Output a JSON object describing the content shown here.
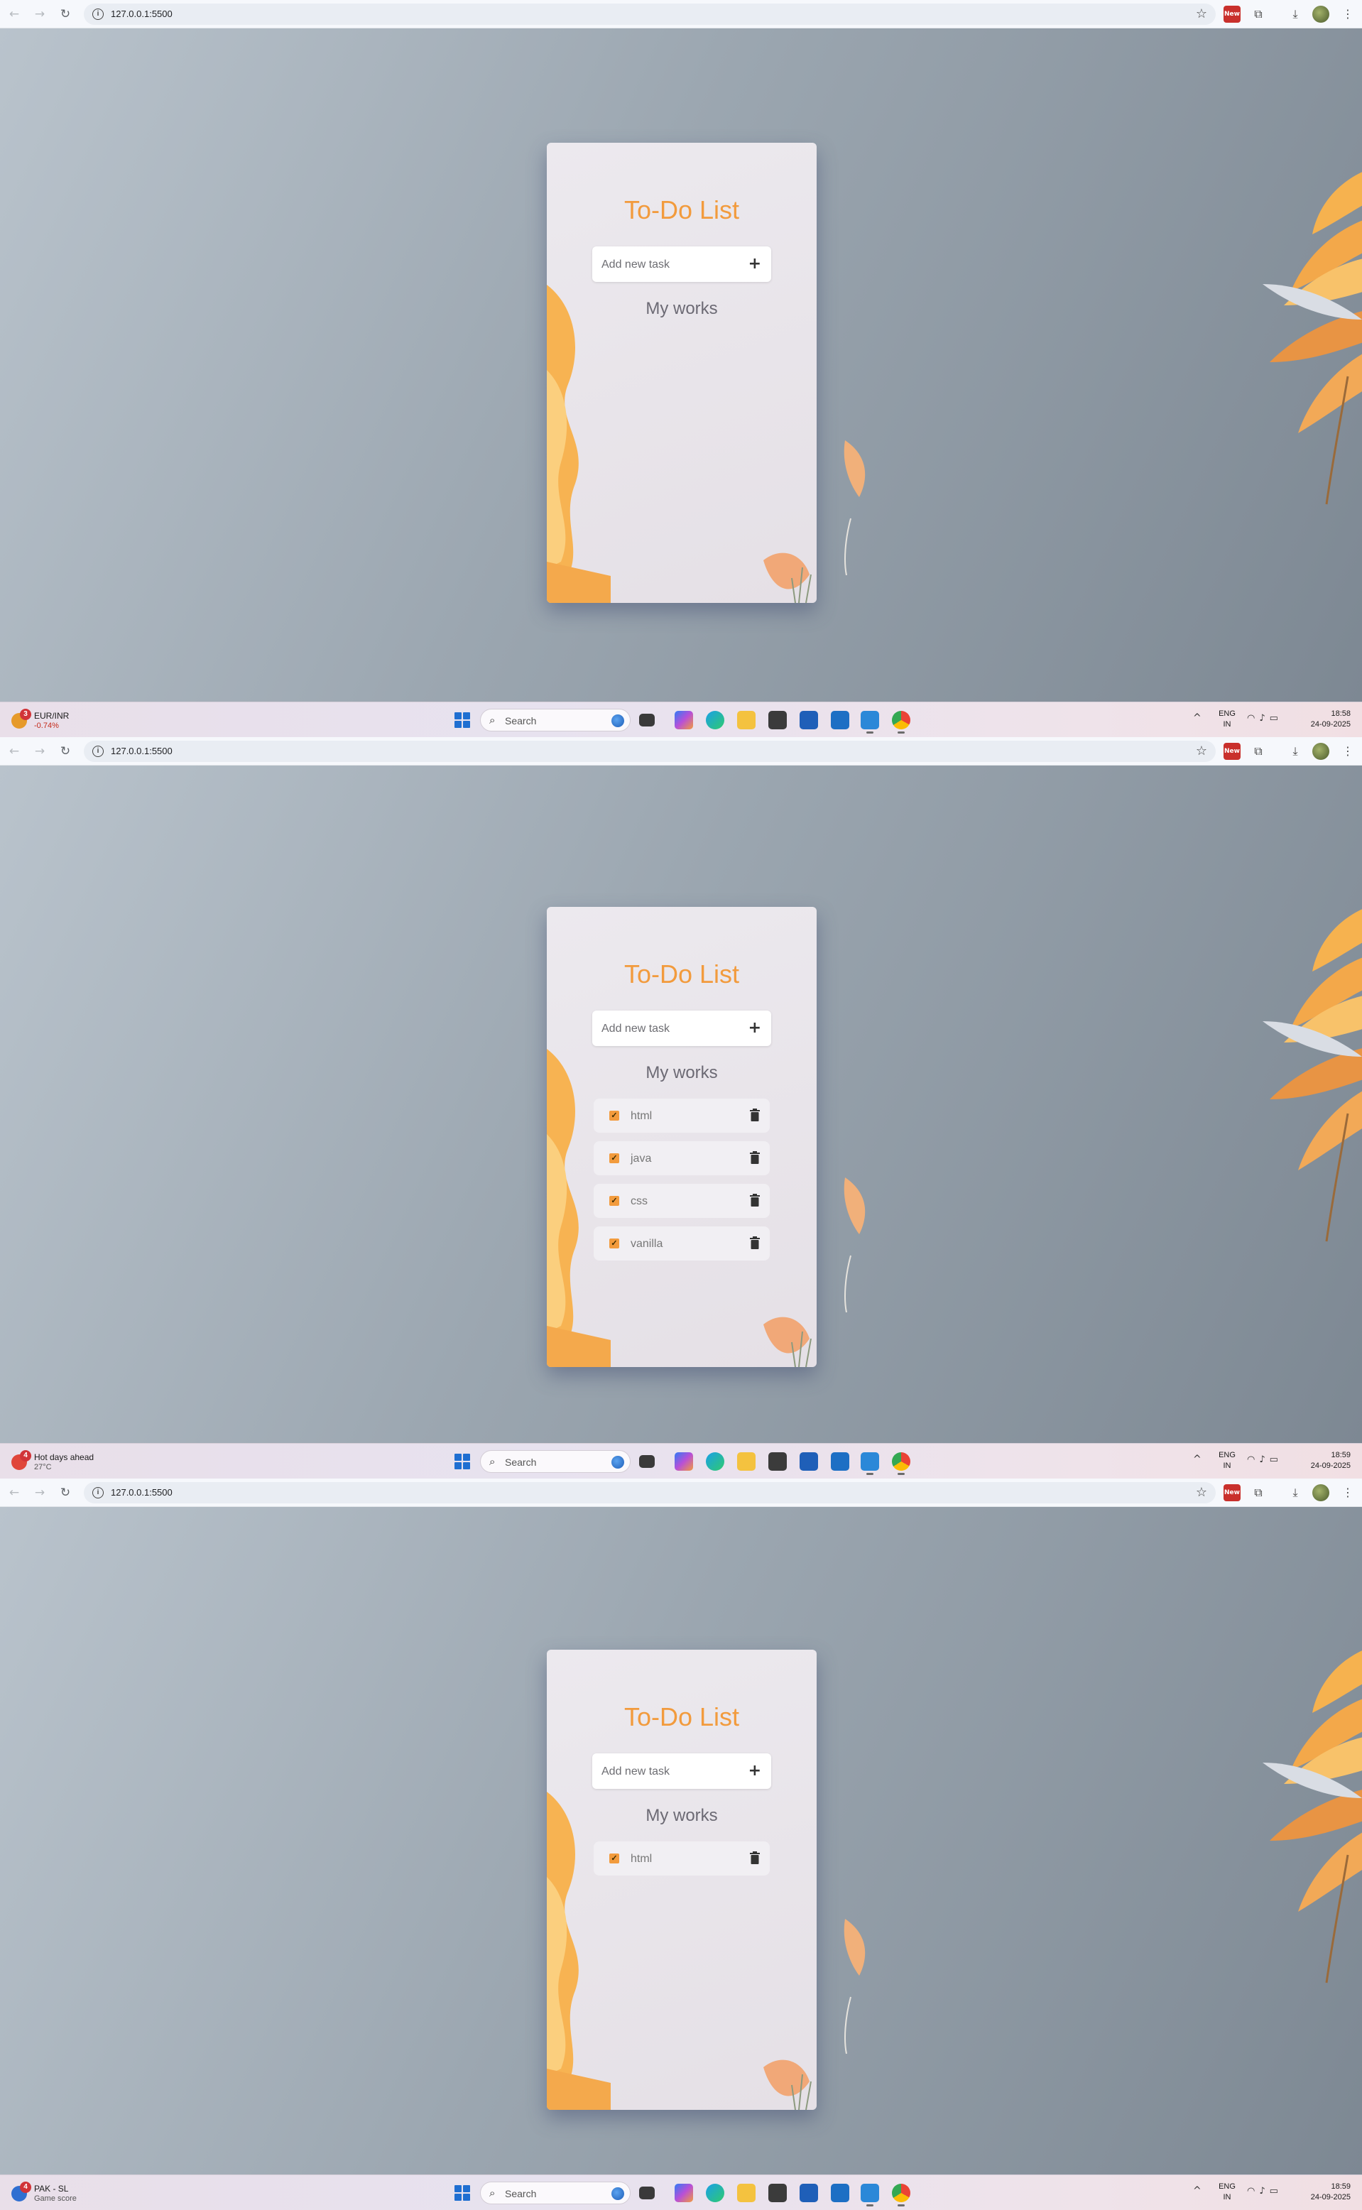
{
  "browser": {
    "url": "127.0.0.1:5500",
    "pdf_badge": "New"
  },
  "app": {
    "title": "To-Do List",
    "input_placeholder": "Add new task",
    "add_icon": "plus-icon",
    "section_title": "My works",
    "accent_color": "#f29b3d"
  },
  "screens": [
    {
      "tasks": [],
      "widget": {
        "badge": "3",
        "line1": "EUR/INR",
        "line2": "-0.74%"
      },
      "clock": {
        "time": "18:58",
        "date": "24-09-2025"
      }
    },
    {
      "tasks": [
        {
          "label": "html",
          "checked": true
        },
        {
          "label": "java",
          "checked": true
        },
        {
          "label": "css",
          "checked": true
        },
        {
          "label": "vanilla",
          "checked": true
        }
      ],
      "widget": {
        "badge": "4",
        "line1": "Hot days ahead",
        "line2": "27°C"
      },
      "clock": {
        "time": "18:59",
        "date": "24-09-2025"
      }
    },
    {
      "tasks": [
        {
          "label": "html",
          "checked": true
        }
      ],
      "widget": {
        "badge": "4",
        "line1": "PAK - SL",
        "line2": "Game score"
      },
      "clock": {
        "time": "18:59",
        "date": "24-09-2025"
      }
    }
  ],
  "taskbar": {
    "search_label": "Search",
    "lang_line1": "ENG",
    "lang_line2": "IN"
  }
}
